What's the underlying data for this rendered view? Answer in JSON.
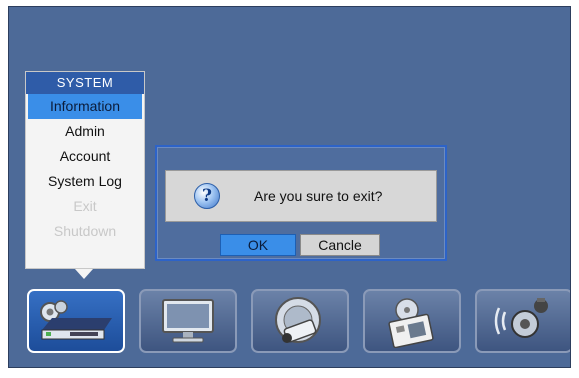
{
  "menu": {
    "header": "SYSTEM",
    "items": [
      {
        "label": "Information",
        "state": "selected"
      },
      {
        "label": "Admin",
        "state": "normal"
      },
      {
        "label": "Account",
        "state": "normal"
      },
      {
        "label": "System Log",
        "state": "normal"
      },
      {
        "label": "Exit",
        "state": "disabled"
      },
      {
        "label": "Shutdown",
        "state": "disabled"
      }
    ]
  },
  "dialog": {
    "message": "Are you sure to exit?",
    "ok_label": "OK",
    "cancel_label": "Cancle",
    "icon": "question-icon"
  },
  "toolbar": {
    "tiles": [
      {
        "icon": "dvr-system-icon",
        "active": true
      },
      {
        "icon": "monitor-display-icon",
        "active": false
      },
      {
        "icon": "camera-recording-icon",
        "active": false
      },
      {
        "icon": "backup-media-icon",
        "active": false
      },
      {
        "icon": "audio-alarm-icon",
        "active": false
      }
    ]
  },
  "colors": {
    "background": "#4d6a98",
    "accent": "#3a8ee8",
    "menu_header": "#2f5ca8"
  }
}
